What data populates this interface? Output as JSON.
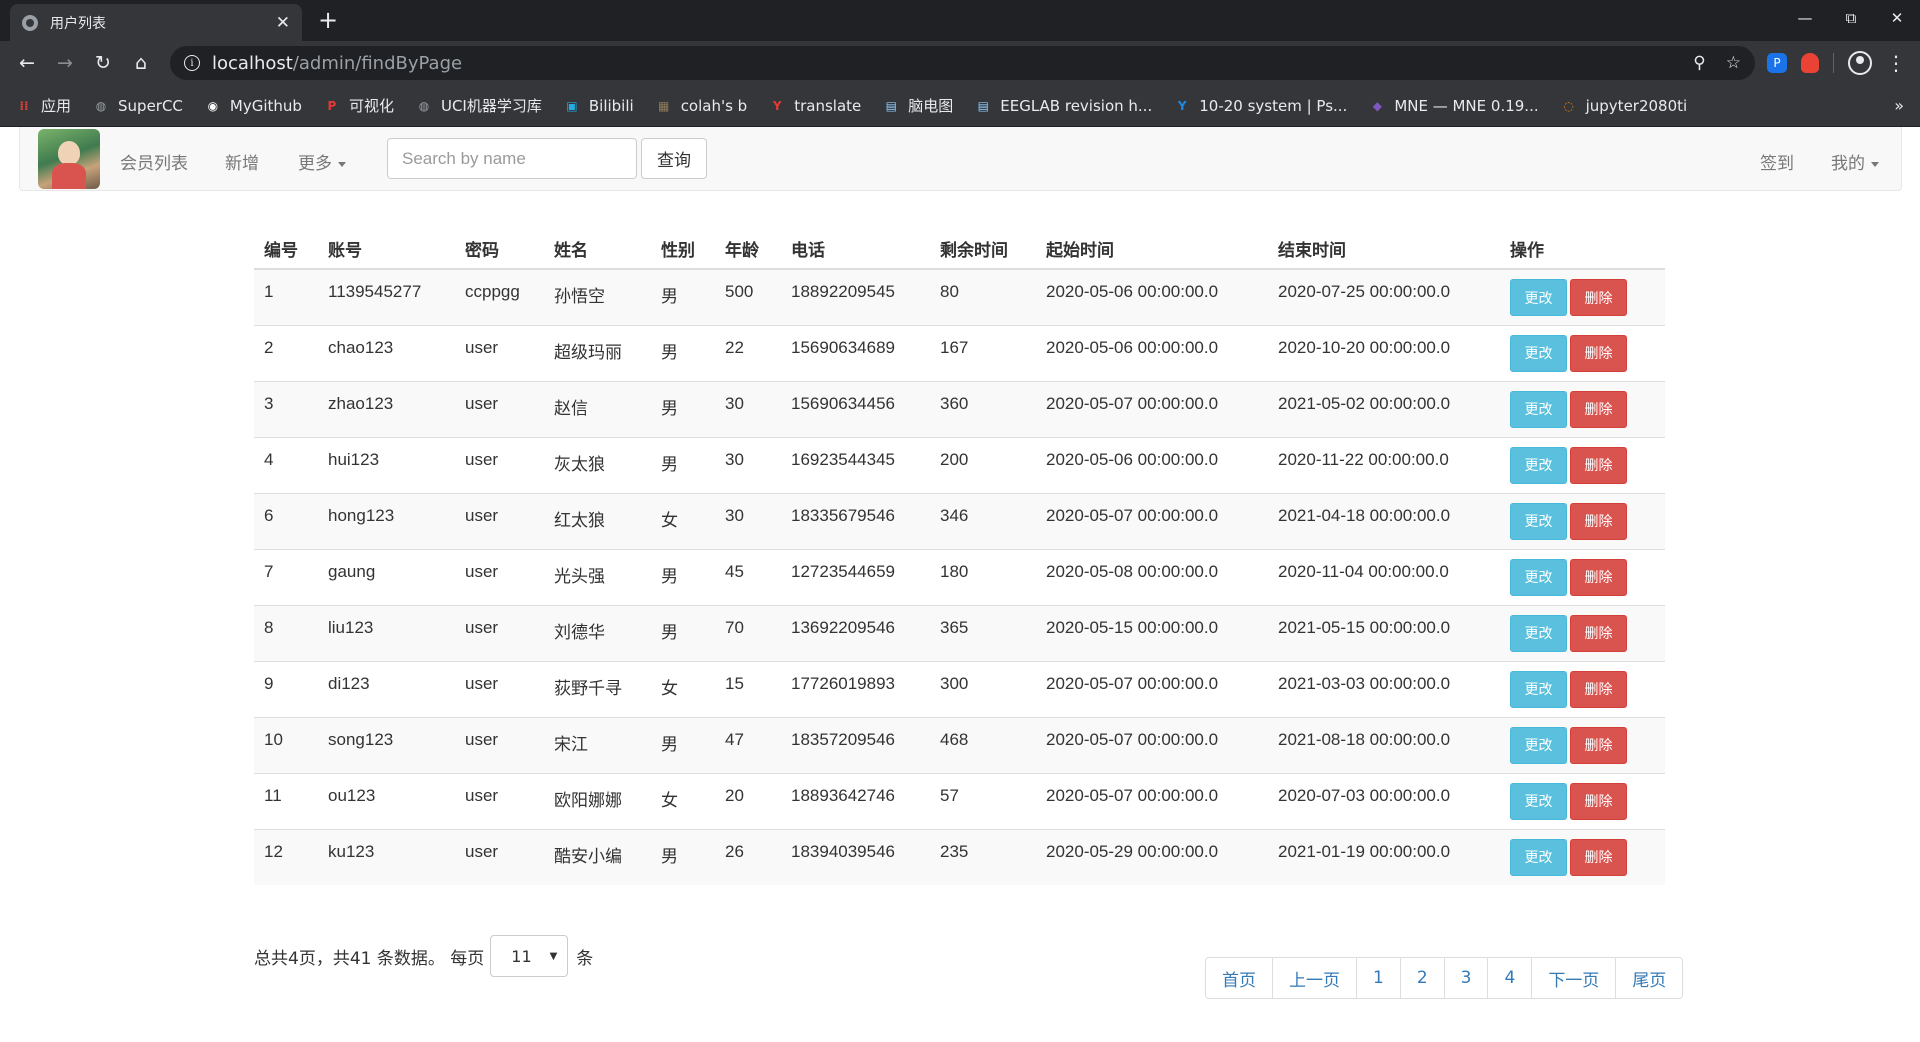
{
  "browser": {
    "tab_title": "用户列表",
    "url_host": "localhost",
    "url_path": "/admin/findByPage",
    "bookmarks": [
      {
        "label": "应用",
        "icon": "apps-grid-icon",
        "color": "#ea4335"
      },
      {
        "label": "SuperCC",
        "icon": "globe-icon",
        "color": "#9aa0a6"
      },
      {
        "label": "MyGithub",
        "icon": "github-icon",
        "color": "#ffffff"
      },
      {
        "label": "可视化",
        "icon": "p-logo-icon",
        "color": "#e53935"
      },
      {
        "label": "UCI机器学习库",
        "icon": "globe-icon",
        "color": "#9aa0a6"
      },
      {
        "label": "Bilibili",
        "icon": "bilibili-icon",
        "color": "#23ade5"
      },
      {
        "label": "colah's b",
        "icon": "blog-icon",
        "color": "#8d7b5a"
      },
      {
        "label": "translate",
        "icon": "yandex-icon",
        "color": "#e53935"
      },
      {
        "label": "脑电图",
        "icon": "page-icon",
        "color": "#90caf9"
      },
      {
        "label": "EEGLAB revision h...",
        "icon": "page-icon",
        "color": "#90caf9"
      },
      {
        "label": "10-20 system | Ps...",
        "icon": "site-icon",
        "color": "#1e88e5"
      },
      {
        "label": "MNE — MNE 0.19...",
        "icon": "mne-icon",
        "color": "#7e57c2"
      },
      {
        "label": "jupyter2080ti",
        "icon": "jupyter-icon",
        "color": "#f57c00"
      }
    ],
    "more_label": "»"
  },
  "navbar": {
    "links": [
      "会员列表",
      "新增"
    ],
    "more_label": "更多",
    "search_placeholder": "Search by name",
    "search_button": "查询",
    "signin_label": "签到",
    "mine_label": "我的"
  },
  "table": {
    "headers": [
      "编号",
      "账号",
      "密码",
      "姓名",
      "性别",
      "年龄",
      "电话",
      "剩余时间",
      "起始时间",
      "结束时间",
      "操作"
    ],
    "edit_label": "更改",
    "delete_label": "删除",
    "rows": [
      [
        "1",
        "1139545277",
        "ccppgg",
        "孙悟空",
        "男",
        "500",
        "18892209545",
        "80",
        "2020-05-06 00:00:00.0",
        "2020-07-25 00:00:00.0"
      ],
      [
        "2",
        "chao123",
        "user",
        "超级玛丽",
        "男",
        "22",
        "15690634689",
        "167",
        "2020-05-06 00:00:00.0",
        "2020-10-20 00:00:00.0"
      ],
      [
        "3",
        "zhao123",
        "user",
        "赵信",
        "男",
        "30",
        "15690634456",
        "360",
        "2020-05-07 00:00:00.0",
        "2021-05-02 00:00:00.0"
      ],
      [
        "4",
        "hui123",
        "user",
        "灰太狼",
        "男",
        "30",
        "16923544345",
        "200",
        "2020-05-06 00:00:00.0",
        "2020-11-22 00:00:00.0"
      ],
      [
        "6",
        "hong123",
        "user",
        "红太狼",
        "女",
        "30",
        "18335679546",
        "346",
        "2020-05-07 00:00:00.0",
        "2021-04-18 00:00:00.0"
      ],
      [
        "7",
        "gaung",
        "user",
        "光头强",
        "男",
        "45",
        "12723544659",
        "180",
        "2020-05-08 00:00:00.0",
        "2020-11-04 00:00:00.0"
      ],
      [
        "8",
        "liu123",
        "user",
        "刘德华",
        "男",
        "70",
        "13692209546",
        "365",
        "2020-05-15 00:00:00.0",
        "2021-05-15 00:00:00.0"
      ],
      [
        "9",
        "di123",
        "user",
        "荻野千寻",
        "女",
        "15",
        "17726019893",
        "300",
        "2020-05-07 00:00:00.0",
        "2021-03-03 00:00:00.0"
      ],
      [
        "10",
        "song123",
        "user",
        "宋江",
        "男",
        "47",
        "18357209546",
        "468",
        "2020-05-07 00:00:00.0",
        "2021-08-18 00:00:00.0"
      ],
      [
        "11",
        "ou123",
        "user",
        "欧阳娜娜",
        "女",
        "20",
        "18893642746",
        "57",
        "2020-05-07 00:00:00.0",
        "2020-07-03 00:00:00.0"
      ],
      [
        "12",
        "ku123",
        "user",
        "酷安小编",
        "男",
        "26",
        "18394039546",
        "235",
        "2020-05-29 00:00:00.0",
        "2021-01-19 00:00:00.0"
      ]
    ]
  },
  "summary": {
    "prefix": "总共4页，共41 条数据。 每页",
    "page_size": "11",
    "suffix": "条"
  },
  "pagination": [
    "首页",
    "上一页",
    "1",
    "2",
    "3",
    "4",
    "下一页",
    "尾页"
  ]
}
